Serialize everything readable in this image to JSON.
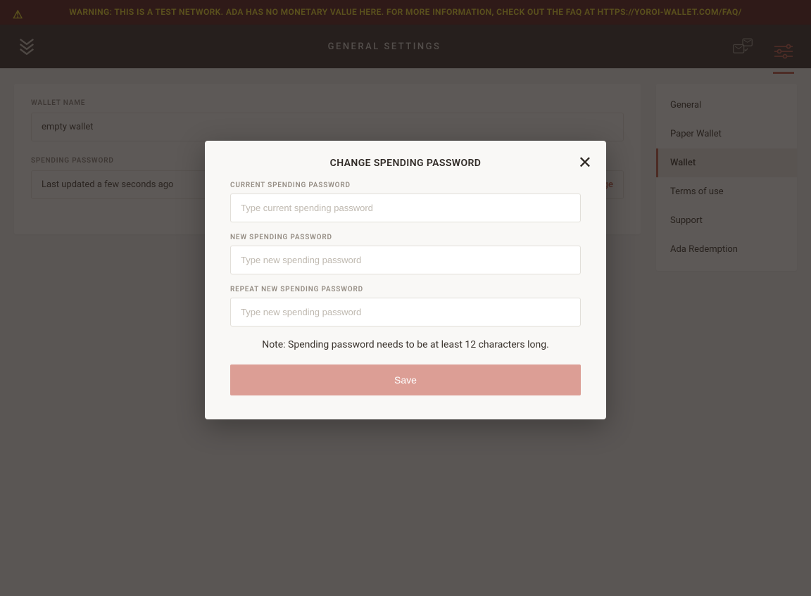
{
  "banner": {
    "text": "WARNING: THIS IS A TEST NETWORK. ADA HAS NO MONETARY VALUE HERE. FOR MORE INFORMATION, CHECK OUT THE FAQ AT HTTPS://YOROI-WALLET.COM/FAQ/"
  },
  "header": {
    "title": "GENERAL SETTINGS"
  },
  "main": {
    "wallet_name_label": "WALLET NAME",
    "wallet_name_value": "empty wallet",
    "spending_label": "SPENDING PASSWORD",
    "spending_value": "Last updated a few seconds ago",
    "change_label": "change"
  },
  "sidebar": {
    "items": [
      {
        "label": "General"
      },
      {
        "label": "Paper Wallet"
      },
      {
        "label": "Wallet"
      },
      {
        "label": "Terms of use"
      },
      {
        "label": "Support"
      },
      {
        "label": "Ada Redemption"
      }
    ],
    "active_index": 2
  },
  "modal": {
    "title": "CHANGE SPENDING PASSWORD",
    "current_label": "CURRENT SPENDING PASSWORD",
    "current_placeholder": "Type current spending password",
    "new_label": "NEW SPENDING PASSWORD",
    "new_placeholder": "Type new spending password",
    "repeat_label": "REPEAT NEW SPENDING PASSWORD",
    "repeat_placeholder": "Type new spending password",
    "note": "Note: Spending password needs to be at least 12 characters long.",
    "save_label": "Save"
  }
}
